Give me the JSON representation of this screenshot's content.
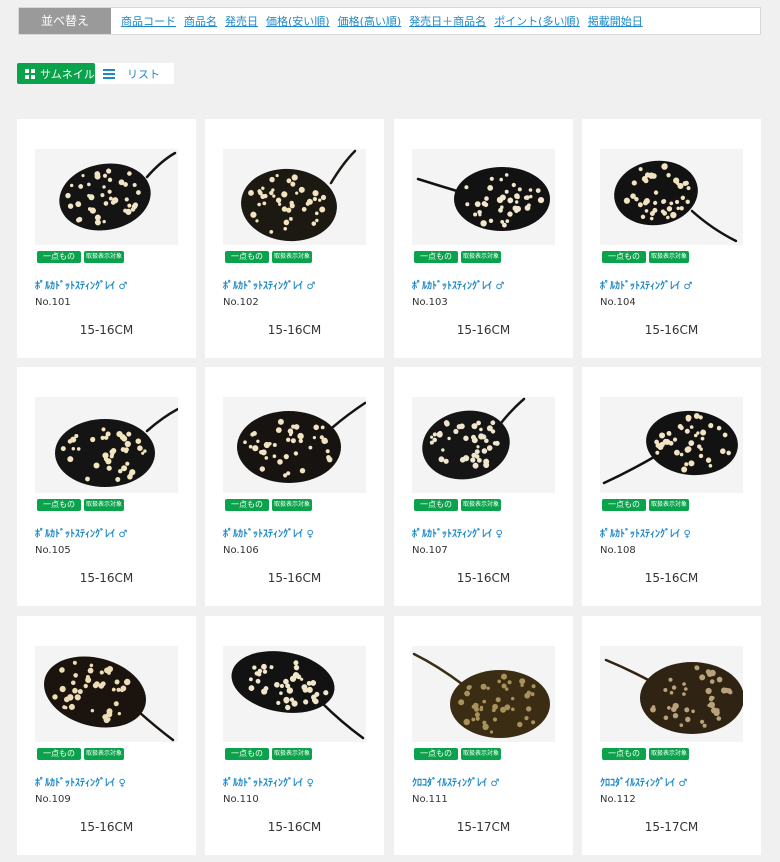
{
  "sort": {
    "label": "並べ替え",
    "options": [
      "商品コード",
      "商品名",
      "発売日",
      "価格(安い順)",
      "価格(高い順)",
      "発売日＋商品名",
      "ポイント(多い順)",
      "掲載開始日"
    ]
  },
  "view": {
    "thumbnail_label": "サムネイル",
    "list_label": "リスト"
  },
  "colors": {
    "accent_green": "#0aa24a",
    "link_blue": "#1e88c8"
  },
  "products": [
    {
      "badge1": "一点もの",
      "badge2": "取扱表示対象",
      "name": "ﾎﾟﾙｶﾄﾞｯﾄｽﾃｨﾝｸﾞﾚｲ ♂",
      "no": "No.101",
      "size": "15-16CM"
    },
    {
      "badge1": "一点もの",
      "badge2": "取扱表示対象",
      "name": "ﾎﾟﾙｶﾄﾞｯﾄｽﾃｨﾝｸﾞﾚｲ ♂",
      "no": "No.102",
      "size": "15-16CM"
    },
    {
      "badge1": "一点もの",
      "badge2": "取扱表示対象",
      "name": "ﾎﾟﾙｶﾄﾞｯﾄｽﾃｨﾝｸﾞﾚｲ ♂",
      "no": "No.103",
      "size": "15-16CM"
    },
    {
      "badge1": "一点もの",
      "badge2": "取扱表示対象",
      "name": "ﾎﾟﾙｶﾄﾞｯﾄｽﾃｨﾝｸﾞﾚｲ ♂",
      "no": "No.104",
      "size": "15-16CM"
    },
    {
      "badge1": "一点もの",
      "badge2": "取扱表示対象",
      "name": "ﾎﾟﾙｶﾄﾞｯﾄｽﾃｨﾝｸﾞﾚｲ ♂",
      "no": "No.105",
      "size": "15-16CM"
    },
    {
      "badge1": "一点もの",
      "badge2": "取扱表示対象",
      "name": "ﾎﾟﾙｶﾄﾞｯﾄｽﾃｨﾝｸﾞﾚｲ ♀",
      "no": "No.106",
      "size": "15-16CM"
    },
    {
      "badge1": "一点もの",
      "badge2": "取扱表示対象",
      "name": "ﾎﾟﾙｶﾄﾞｯﾄｽﾃｨﾝｸﾞﾚｲ ♀",
      "no": "No.107",
      "size": "15-16CM"
    },
    {
      "badge1": "一点もの",
      "badge2": "取扱表示対象",
      "name": "ﾎﾟﾙｶﾄﾞｯﾄｽﾃｨﾝｸﾞﾚｲ ♀",
      "no": "No.108",
      "size": "15-16CM"
    },
    {
      "badge1": "一点もの",
      "badge2": "取扱表示対象",
      "name": "ﾎﾟﾙｶﾄﾞｯﾄｽﾃｨﾝｸﾞﾚｲ ♀",
      "no": "No.109",
      "size": "15-16CM"
    },
    {
      "badge1": "一点もの",
      "badge2": "取扱表示対象",
      "name": "ﾎﾟﾙｶﾄﾞｯﾄｽﾃｨﾝｸﾞﾚｲ ♀",
      "no": "No.110",
      "size": "15-16CM"
    },
    {
      "badge1": "一点もの",
      "badge2": "取扱表示対象",
      "name": "ｸﾛｺﾀﾞｲﾙｽﾃｨﾝｸﾞﾚｲ ♂",
      "no": "No.111",
      "size": "15-17CM"
    },
    {
      "badge1": "一点もの",
      "badge2": "取扱表示対象",
      "name": "ｸﾛｺﾀﾞｲﾙｽﾃｨﾝｸﾞﾚｲ ♂",
      "no": "No.112",
      "size": "15-17CM"
    }
  ]
}
